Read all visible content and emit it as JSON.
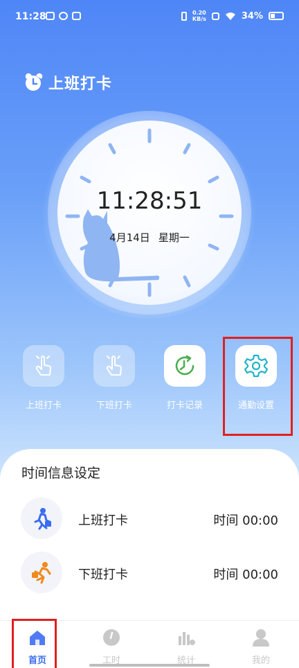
{
  "status_bar": {
    "time": "11:28",
    "net_speed_value": "0.20",
    "net_speed_unit": "KB/s",
    "battery": "34%"
  },
  "header": {
    "title": "上班打卡",
    "icon": "alarm-clock-icon"
  },
  "clock": {
    "time": "11:28:51",
    "date": "4月14日",
    "weekday": "星期一"
  },
  "actions": [
    {
      "label": "上班打卡",
      "icon": "tap-hand-icon"
    },
    {
      "label": "下班打卡",
      "icon": "tap-hand-icon"
    },
    {
      "label": "打卡记录",
      "icon": "history-clock-icon"
    },
    {
      "label": "通勤设置",
      "icon": "gear-icon"
    }
  ],
  "info": {
    "title": "时间信息设定",
    "rows": [
      {
        "name": "上班打卡",
        "time": "时间 00:00",
        "icon": "commuter-walking-icon"
      },
      {
        "name": "下班打卡",
        "time": "时间 00:00",
        "icon": "commuter-running-icon"
      }
    ]
  },
  "tabs": [
    {
      "label": "首页",
      "icon": "home-icon",
      "active": true
    },
    {
      "label": "工时",
      "icon": "clock-icon",
      "active": false
    },
    {
      "label": "统计",
      "icon": "bar-chart-icon",
      "active": false
    },
    {
      "label": "我的",
      "icon": "user-icon",
      "active": false
    }
  ],
  "colors": {
    "accent": "#3b6cf0",
    "hero_top": "#4f86f7",
    "highlight": "#e02020",
    "green": "#4caf50",
    "teal": "#1fb5c8",
    "orange": "#f08a1c"
  }
}
